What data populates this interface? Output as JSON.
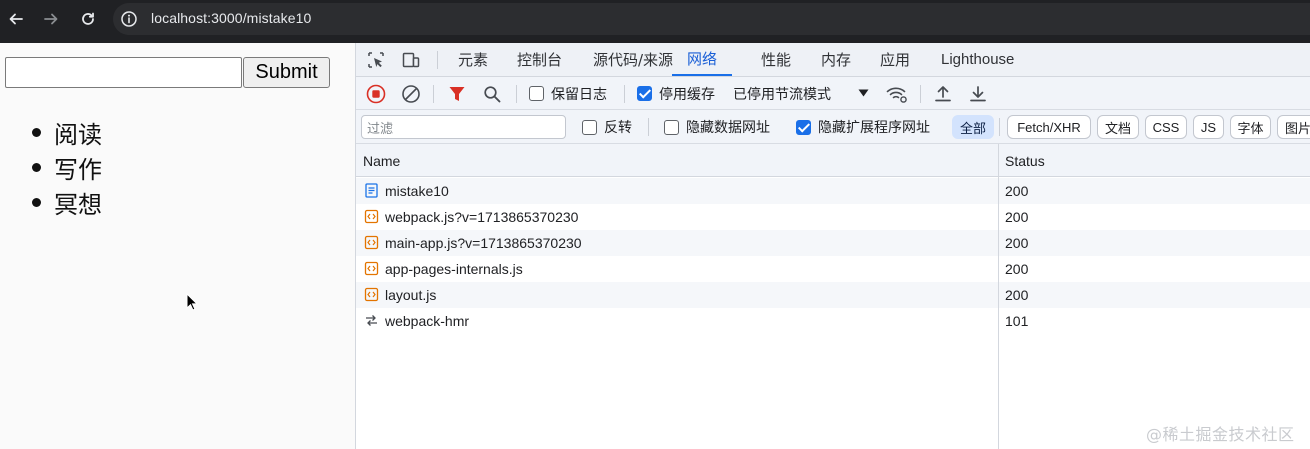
{
  "browser": {
    "url": "localhost:3000/mistake10"
  },
  "page": {
    "input_value": "",
    "submit_label": "Submit",
    "todos": [
      "阅读",
      "写作",
      "冥想"
    ]
  },
  "devtools": {
    "tabs": [
      "元素",
      "控制台",
      "源代码/来源",
      "网络",
      "性能",
      "内存",
      "应用",
      "Lighthouse"
    ],
    "active_tab": "网络",
    "toolbar": {
      "preserve_log_label": "保留日志",
      "preserve_log_checked": false,
      "disable_cache_label": "停用缓存",
      "disable_cache_checked": true,
      "throttling_label": "已停用节流模式"
    },
    "filter": {
      "placeholder": "过滤",
      "invert_label": "反转",
      "hide_data_urls_label": "隐藏数据网址",
      "hide_extension_urls_label": "隐藏扩展程序网址",
      "types": [
        "全部",
        "Fetch/XHR",
        "文档",
        "CSS",
        "JS",
        "字体",
        "图片"
      ],
      "active_type": "全部"
    },
    "table": {
      "columns": [
        "Name",
        "Status"
      ],
      "rows": [
        {
          "name": "mistake10",
          "status": "200",
          "icon": "document-icon"
        },
        {
          "name": "webpack.js?v=1713865370230",
          "status": "200",
          "icon": "script-icon"
        },
        {
          "name": "main-app.js?v=1713865370230",
          "status": "200",
          "icon": "script-icon"
        },
        {
          "name": "app-pages-internals.js",
          "status": "200",
          "icon": "script-icon"
        },
        {
          "name": "layout.js",
          "status": "200",
          "icon": "script-icon"
        },
        {
          "name": "webpack-hmr",
          "status": "101",
          "icon": "websocket-icon"
        }
      ]
    }
  },
  "watermark": "@稀土掘金技术社区",
  "colors": {
    "accent": "#1a6fe8",
    "record_red": "#d93025",
    "filter_red": "#d93025",
    "script_orange": "#e37400",
    "doc_blue": "#1a73e8"
  }
}
